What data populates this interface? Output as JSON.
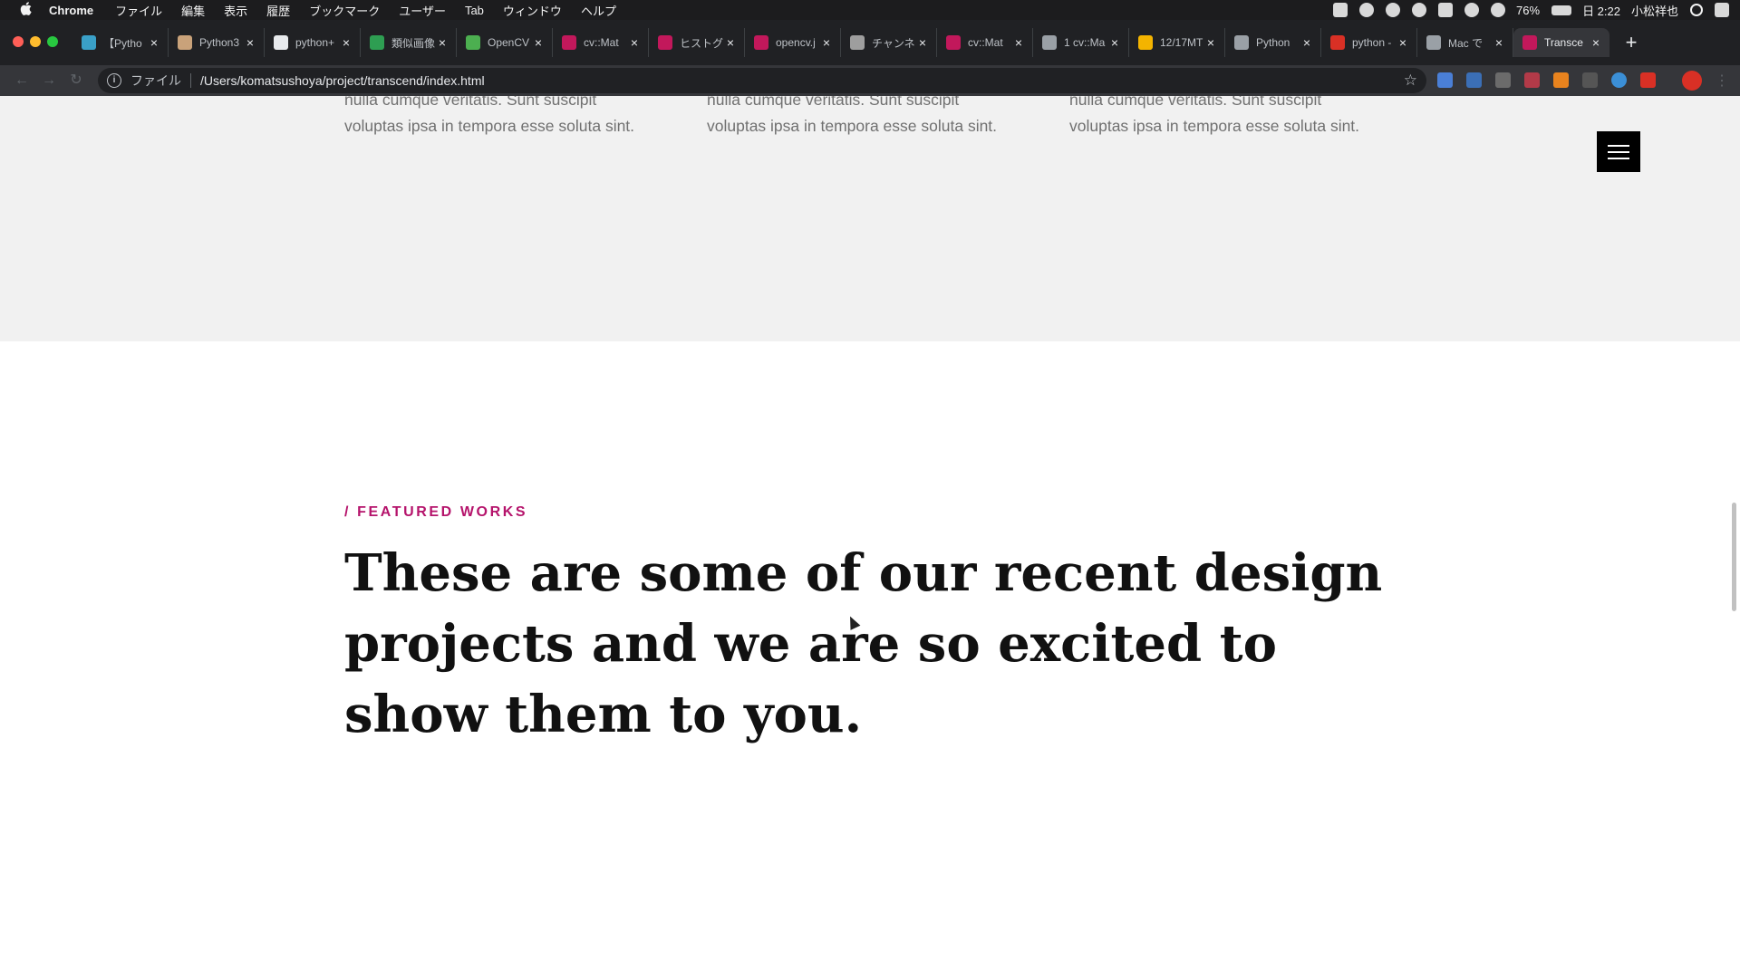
{
  "menubar": {
    "apple": "",
    "app": "Chrome",
    "items": [
      "ファイル",
      "編集",
      "表示",
      "履歴",
      "ブックマーク",
      "ユーザー",
      "Tab",
      "ウィンドウ",
      "ヘルプ"
    ],
    "battery": "76%",
    "clock": "日 2:22",
    "user": "小松祥也"
  },
  "tabs": [
    {
      "title": "【Pytho",
      "favicon_color": "#3aa0c8"
    },
    {
      "title": "Python3",
      "favicon_color": "#c9a27a"
    },
    {
      "title": "python+",
      "favicon_color": "#e8eaed"
    },
    {
      "title": "類似画像",
      "favicon_color": "#2e9e52"
    },
    {
      "title": "OpenCV",
      "favicon_color": "#4caf50"
    },
    {
      "title": "cv::Mat",
      "favicon_color": "#c2185b"
    },
    {
      "title": "ヒストグ",
      "favicon_color": "#c2185b"
    },
    {
      "title": "opencv.j",
      "favicon_color": "#c2185b"
    },
    {
      "title": "チャンネ",
      "favicon_color": "#9e9e9e"
    },
    {
      "title": "cv::Mat",
      "favicon_color": "#c2185b"
    },
    {
      "title": "1 cv::Ma",
      "favicon_color": "#9aa0a6"
    },
    {
      "title": "12/17MT",
      "favicon_color": "#f4b400"
    },
    {
      "title": "Python",
      "favicon_color": "#9aa0a6"
    },
    {
      "title": "python -",
      "favicon_color": "#d93025"
    },
    {
      "title": "Mac で",
      "favicon_color": "#9aa0a6"
    },
    {
      "title": "Transce",
      "favicon_color": "#c2185b",
      "active": true
    }
  ],
  "tab_close_glyph": "×",
  "newtab_glyph": "+",
  "omnibox": {
    "scheme": "ファイル",
    "url": "/Users/komatsushoya/project/transcend/index.html"
  },
  "page": {
    "services_text_line1": "nulla cumque veritatis. Sunt suscipit",
    "services_text_line2": "voluptas ipsa in tempora esse soluta sint.",
    "kicker": "/ FEATURED WORKS",
    "headline": "These are some of our recent design projects and we are so excited to show them to you.",
    "accent_color": "#b5136b"
  },
  "icons": {
    "back": "back-arrow-icon",
    "forward": "forward-arrow-icon",
    "reload": "reload-icon",
    "star": "bookmark-star-icon",
    "menu": "hamburger-menu-icon"
  }
}
